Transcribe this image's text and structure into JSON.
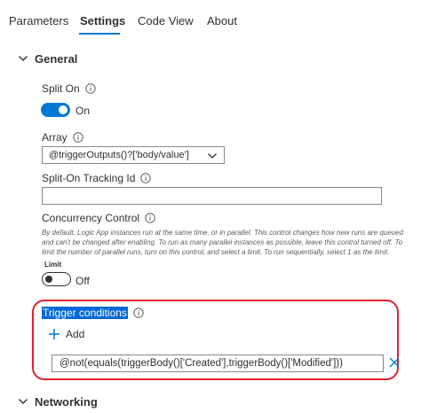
{
  "tabs": [
    {
      "label": "Parameters"
    },
    {
      "label": "Settings"
    },
    {
      "label": "Code View"
    },
    {
      "label": "About"
    }
  ],
  "general": {
    "title": "General",
    "split_on": {
      "label": "Split On",
      "state": "On"
    },
    "array": {
      "label": "Array",
      "value": "@triggerOutputs()?['body/value']"
    },
    "tracking": {
      "label": "Split-On Tracking Id",
      "value": ""
    },
    "concurrency": {
      "label": "Concurrency Control",
      "description": "By default, Logic App instances run at the same time, or in parallel. This control changes how new runs are queued and can't be changed after enabling. To run as many parallel instances as possible, leave this control turned off. To limit the number of parallel runs, turn on this control, and select a limit. To run sequentially, select 1 as the limit.",
      "limit_label": "Limit",
      "limit_state": "Off"
    },
    "trigger_conditions": {
      "label": "Trigger conditions",
      "add_label": "Add",
      "conditions": [
        "@not(equals(triggerBody()['Created'],triggerBody()['Modified']))"
      ]
    }
  },
  "networking": {
    "title": "Networking"
  },
  "colors": {
    "accent": "#0078d4",
    "highlight_border": "#e3202e"
  }
}
